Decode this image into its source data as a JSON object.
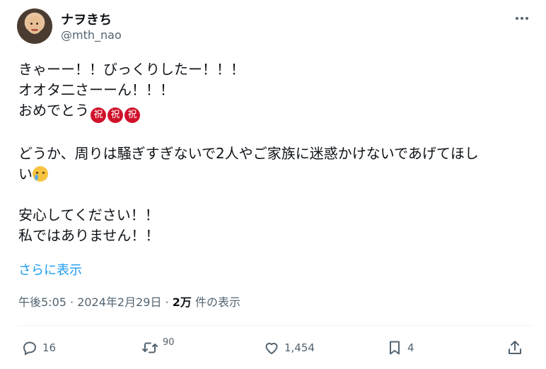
{
  "author": {
    "display_name": "ナヲきち",
    "handle": "@mth_nao"
  },
  "tweet": {
    "lines": {
      "l1": "きゃーー！！びっくりしたー！！！",
      "l2": "オオタ二さーーん！！！",
      "l3": "おめでとう",
      "l4": "どうか、周りは騒ぎすぎないで2人やご家族に迷惑かけないであげてほし",
      "l5": "い",
      "l6": "安心してください！！",
      "l7": "私ではありません！！"
    },
    "seal_char": "祝",
    "show_more": "さらに表示"
  },
  "meta": {
    "time_date": "午後5:05 · 2024年2月29日 · ",
    "views_count": "2万",
    "views_label": " 件の表示"
  },
  "actions": {
    "reply_count": "16",
    "retweet_count": "90",
    "like_count": "1,454",
    "bookmark_count": "4"
  },
  "colors": {
    "accent": "#1d9bf0",
    "muted": "#536471",
    "text": "#0f1419",
    "seal": "#d0112b"
  },
  "icons": [
    "more-icon",
    "reply-icon",
    "retweet-icon",
    "like-icon",
    "bookmark-icon",
    "share-icon"
  ]
}
